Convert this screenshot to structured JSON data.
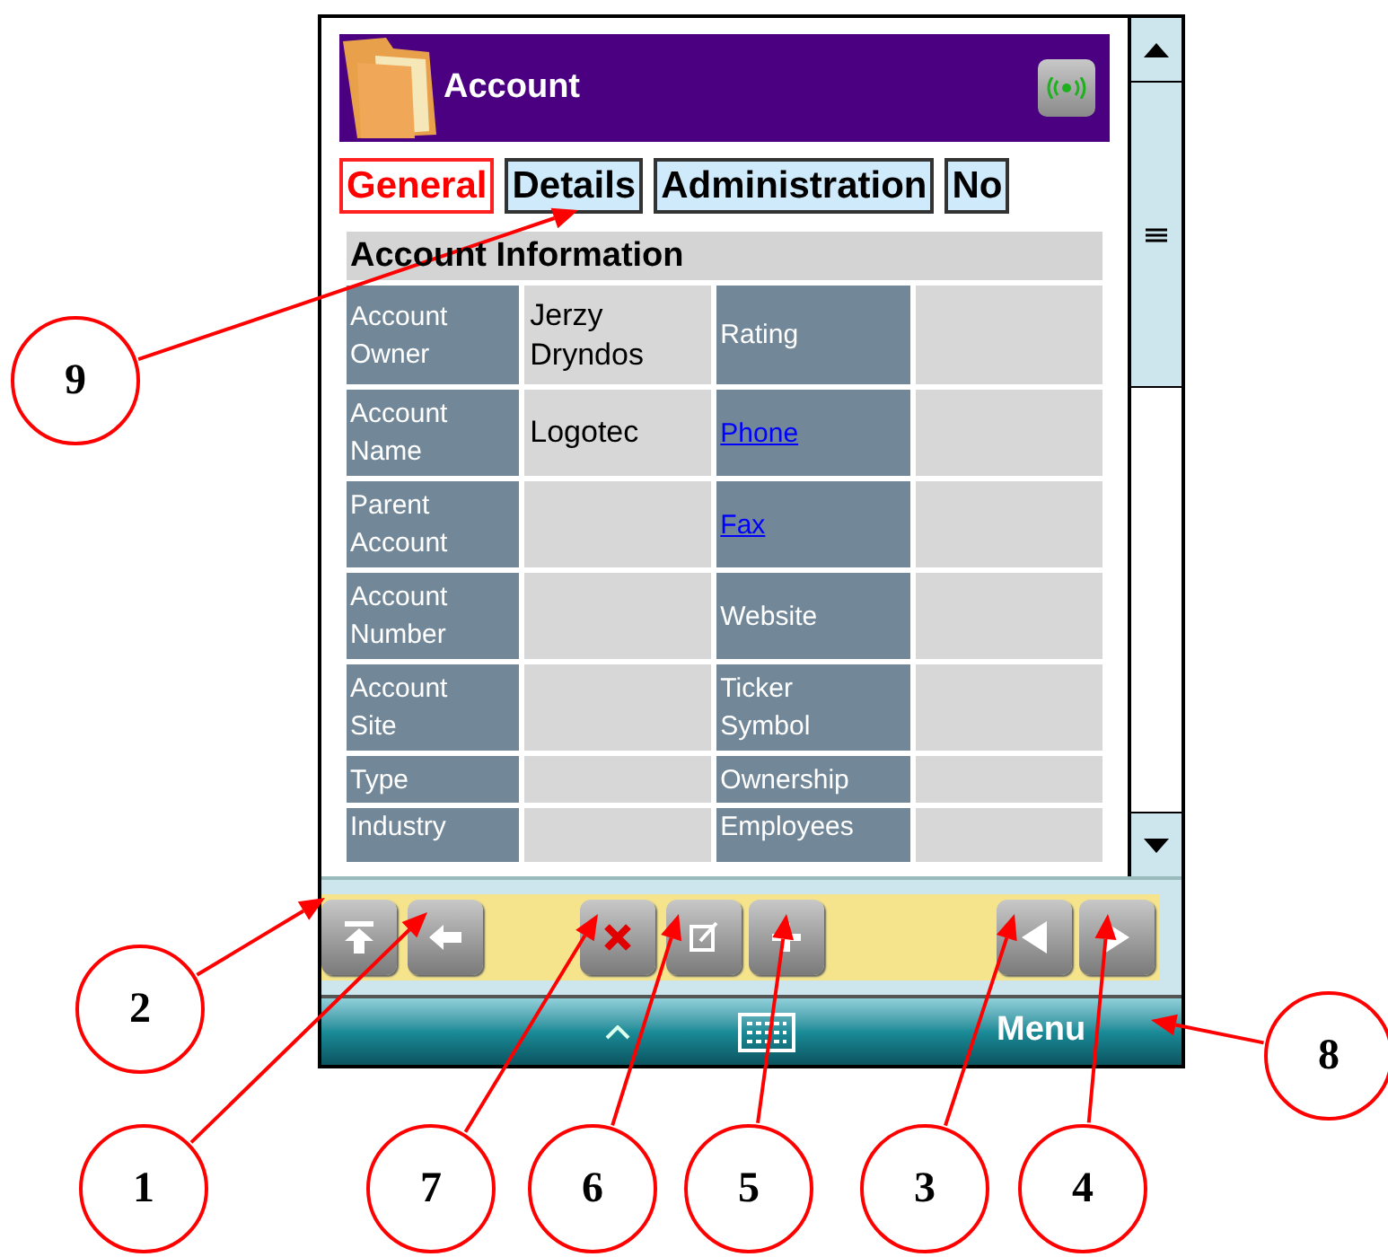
{
  "header": {
    "title": "Account"
  },
  "tabs": [
    {
      "label": "General",
      "selected": true
    },
    {
      "label": "Details",
      "selected": false
    },
    {
      "label": "Administration",
      "selected": false
    },
    {
      "label": "No",
      "selected": false
    }
  ],
  "section": {
    "title": "Account Information"
  },
  "rows": [
    {
      "label": "Account Owner",
      "value": "Jerzy Dryndos",
      "label2": "Rating",
      "kind": "text"
    },
    {
      "label": "Account Name",
      "value": "Logotec",
      "label2": "Phone",
      "kind": "link"
    },
    {
      "label": "Parent Account",
      "label2": "Fax",
      "kind": "link"
    },
    {
      "label": "Account Number",
      "label2": "Website",
      "kind": "text"
    },
    {
      "label": "Account Site",
      "label2": "Ticker Symbol",
      "kind": "text"
    },
    {
      "label": "Type",
      "label2": "Ownership",
      "kind": "text"
    },
    {
      "label": "Industry",
      "label2": "Employees",
      "kind": "text"
    }
  ],
  "softkeys": {
    "menu": "Menu"
  },
  "callouts": [
    "9",
    "2",
    "1",
    "7",
    "6",
    "5",
    "3",
    "4",
    "8"
  ]
}
